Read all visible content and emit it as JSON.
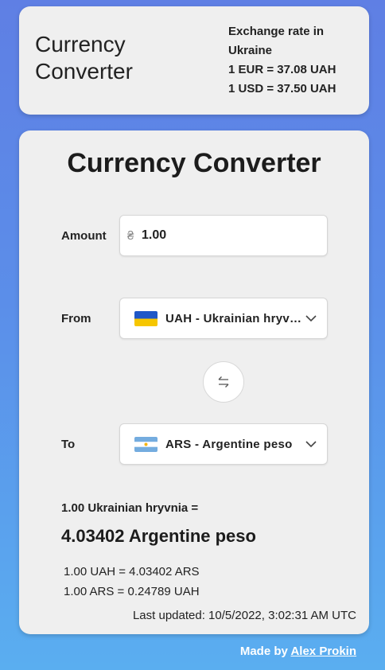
{
  "header": {
    "title": "Currency Converter",
    "rates_title": "Exchange rate in Ukraine",
    "eur_rate": "1 EUR = 37.08 UAH",
    "usd_rate": "1 USD = 37.50 UAH"
  },
  "converter": {
    "title": "Currency Converter",
    "amount_label": "Amount",
    "amount_symbol": "₴",
    "amount_value": "1.00",
    "from_label": "From",
    "from_value": "UAH - Ukrainian hryvnia",
    "to_label": "To",
    "to_value": "ARS - Argentine peso",
    "swap_icon": "swap-arrows-icon"
  },
  "result": {
    "prefix": "1.00 Ukrainian hryvnia =",
    "main": "4.03402 Argentine peso",
    "rate_forward": "1.00 UAH = 4.03402 ARS",
    "rate_reverse": "1.00 ARS = 0.24789 UAH",
    "last_updated": "Last updated: 10/5/2022, 3:02:31 AM UTC"
  },
  "footer": {
    "made_by": "Made by",
    "author": "Alex Prokin"
  },
  "colors": {
    "background_top": "#5f7fe4",
    "background_bottom": "#5aaef0",
    "card": "#efefef",
    "ua_flag_blue": "#1f57c7",
    "ua_flag_yellow": "#f6c600",
    "ar_flag_blue": "#74acdf"
  }
}
